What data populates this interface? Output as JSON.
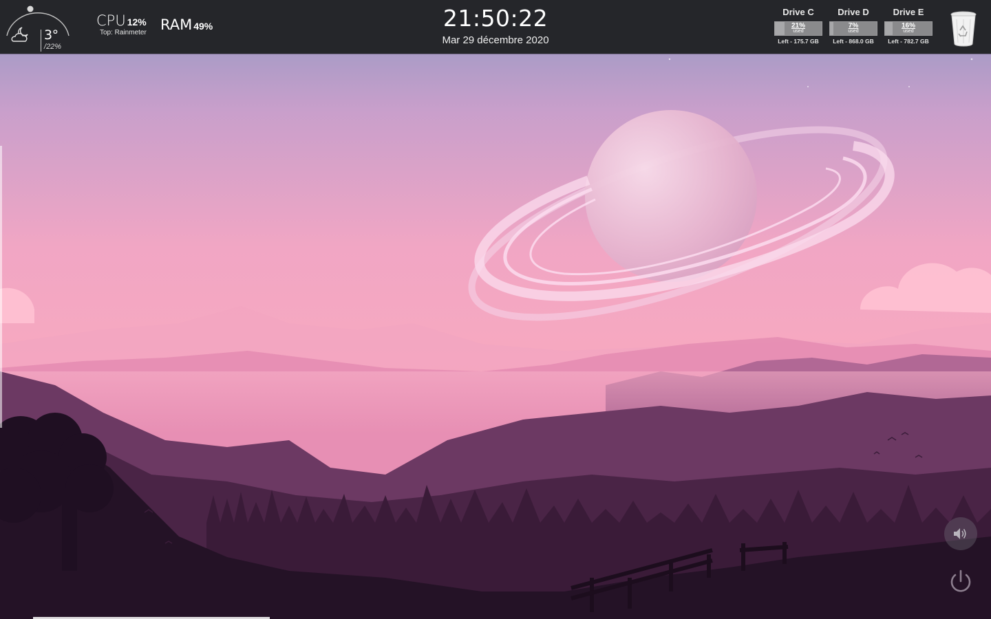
{
  "weather": {
    "temperature": "3°",
    "humidity": "22%",
    "icon": "cloudy-night-icon"
  },
  "cpu": {
    "label": "CPU",
    "value": "12%",
    "top_process": "Top: Rainmeter"
  },
  "ram": {
    "label": "RAM",
    "value": "49%"
  },
  "clock": {
    "time": "21:50:22",
    "date": "Mar 29 décembre 2020"
  },
  "drives": [
    {
      "name": "Drive C",
      "percent": "21%",
      "used_label": "used",
      "left": "Left - 175.7 GB",
      "used_fraction": 0.21
    },
    {
      "name": "Drive D",
      "percent": "7%",
      "used_label": "used",
      "left": "Left - 868.0 GB",
      "used_fraction": 0.07
    },
    {
      "name": "Drive E",
      "percent": "16%",
      "used_label": "used",
      "left": "Left - 782.7 GB",
      "used_fraction": 0.16
    }
  ],
  "icons": {
    "recycle_bin": "recycle-bin-icon",
    "volume": "volume-icon",
    "power": "power-icon"
  },
  "colors": {
    "bar_background": "#25262a",
    "sky_top": "#8f98c2",
    "sky_pink": "#f7a6bd"
  }
}
